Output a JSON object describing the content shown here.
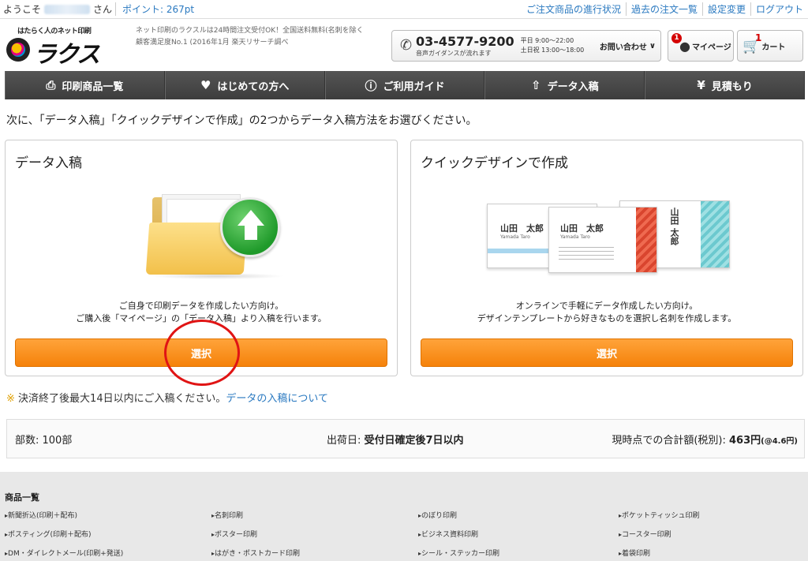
{
  "topbar": {
    "welcome_prefix": "ようこそ",
    "welcome_suffix": "さん",
    "points": "ポイント: 267pt",
    "links": [
      "ご注文商品の進行状況",
      "過去の注文一覧",
      "設定変更",
      "ログアウト"
    ]
  },
  "header": {
    "logo_tag": "はたらく人のネット印刷",
    "logo_word": "ラクスル",
    "tagline_1": "ネット印刷のラクスルは24時間注文受付OK！全国送料無料(名刺を除く",
    "tagline_2": "顧客満足度No.1 (2016年1月 楽天リサーチ調べ",
    "phone": "03-4577-9200",
    "phone_guide": "音声ガイダンスが流れます",
    "hours_weekday": "平日 9:00〜22:00",
    "hours_weekend": "土日祝 13:00〜18:00",
    "contact_label": "お問い合わせ",
    "mypage_label": "マイページ",
    "mypage_badge": "1",
    "cart_label": "カート",
    "cart_count": "1"
  },
  "nav": {
    "items": [
      {
        "label": "印刷商品一覧",
        "icon": "printer-icon"
      },
      {
        "label": "はじめての方へ",
        "icon": "heart-icon"
      },
      {
        "label": "ご利用ガイド",
        "icon": "question-icon"
      },
      {
        "label": "データ入稿",
        "icon": "upload-icon"
      },
      {
        "label": "見積もり",
        "icon": "yen-icon"
      }
    ]
  },
  "main": {
    "instruction": "次に、「データ入稿」「クイックデザインで作成」の2つからデータ入稿方法をお選びください。",
    "left_card": {
      "title": "データ入稿",
      "desc_1": "ご自身で印刷データを作成したい方向け。",
      "desc_2": "ご購入後「マイページ」の「データ入稿」より入稿を行います。",
      "button": "選択"
    },
    "right_card": {
      "title": "クイックデザインで作成",
      "desc_1": "オンラインで手軽にデータ作成したい方向け。",
      "desc_2": "デザインテンプレートから好きなものを選択し名刺を作成します。",
      "button": "選択",
      "sample_name": "山田　太郎",
      "sample_name_short": "山田　太郎",
      "sample_vertical": "山田 太郎",
      "sample_romaji": "Yamada Taro"
    },
    "note_mark": "※",
    "note": "決済終了後最大14日以内にご入稿ください。",
    "note_link": "データの入稿について"
  },
  "summary": {
    "qty": "部数: 100部",
    "ship_label": "出荷日: ",
    "ship_value": "受付日確定後7日以内",
    "total_label": "現時点での合計額(税別): ",
    "total_value": "463円",
    "unit_price": "(@4.6円)"
  },
  "footer": {
    "heading": "商品一覧",
    "items": [
      "新聞折込(印刷＋配布)",
      "名刺印刷",
      "のぼり印刷",
      "ポケットティッシュ印刷",
      "ポスティング(印刷＋配布)",
      "ポスター印刷",
      "ビジネス資料印刷",
      "コースター印刷",
      "DM・ダイレクトメール(印刷+発送)",
      "はがき・ポストカード印刷",
      "シール・ステッカー印刷",
      "着袋印刷"
    ]
  }
}
